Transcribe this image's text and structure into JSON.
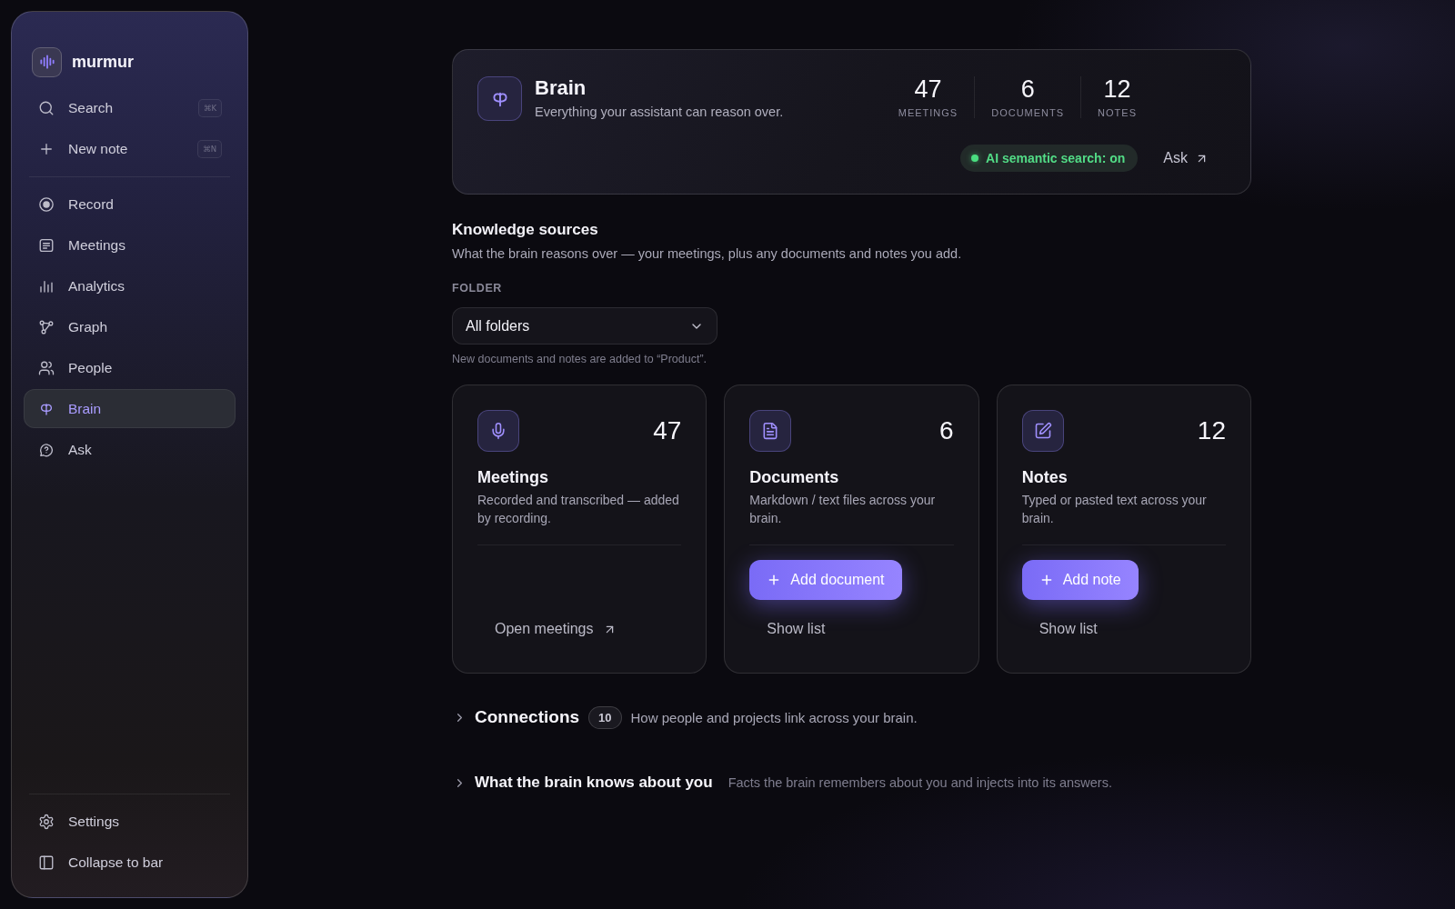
{
  "sidebar": {
    "app_name": "murmur",
    "quick_actions": [
      {
        "kind": "search",
        "label": "Search",
        "shortcut": "⌘K"
      },
      {
        "kind": "new",
        "label": "New note",
        "shortcut": "⌘N"
      }
    ],
    "nav": [
      {
        "kind": "record",
        "label": "Record",
        "selected": false
      },
      {
        "kind": "meetings",
        "label": "Meetings",
        "selected": false
      },
      {
        "kind": "analytics",
        "label": "Analytics",
        "selected": false
      },
      {
        "kind": "graph",
        "label": "Graph",
        "selected": false
      },
      {
        "kind": "people",
        "label": "People",
        "selected": false
      },
      {
        "kind": "brain",
        "label": "Brain",
        "selected": true
      },
      {
        "kind": "ask",
        "label": "Ask",
        "selected": false
      }
    ],
    "footer": [
      {
        "kind": "settings",
        "label": "Settings"
      },
      {
        "kind": "collapse",
        "label": "Collapse to bar"
      }
    ]
  },
  "header": {
    "title": "Brain",
    "subtitle": "Everything your assistant can reason over.",
    "stats": [
      {
        "value": "47",
        "label": "MEETINGS"
      },
      {
        "value": "6",
        "label": "DOCUMENTS"
      },
      {
        "value": "12",
        "label": "NOTES"
      }
    ],
    "semantic_search": {
      "label": "AI semantic search: on",
      "on": true
    },
    "ask_link": "Ask"
  },
  "knowledge_sources": {
    "title": "Knowledge sources",
    "description": "What the brain reasons over — your meetings, plus any documents and notes you add.",
    "folder": {
      "label": "FOLDER",
      "value": "All folders",
      "hint": "New documents and notes are added to “Product”."
    },
    "cards": [
      {
        "kind": "meetings",
        "count": "47",
        "title": "Meetings",
        "description": "Recorded and transcribed — added by recording.",
        "actions": [
          {
            "kind": "link",
            "label": "Open meetings"
          }
        ]
      },
      {
        "kind": "documents",
        "count": "6",
        "title": "Documents",
        "description": "Markdown / text files across your brain.",
        "actions": [
          {
            "kind": "primary",
            "label": "Add document"
          },
          {
            "kind": "ghost",
            "label": "Show list"
          }
        ]
      },
      {
        "kind": "notes",
        "count": "12",
        "title": "Notes",
        "description": "Typed or pasted text across your brain.",
        "actions": [
          {
            "kind": "primary",
            "label": "Add note"
          },
          {
            "kind": "ghost",
            "label": "Show list"
          }
        ]
      }
    ]
  },
  "sections": [
    {
      "kind": "large",
      "title": "Connections",
      "count": "10",
      "description": "How people and projects link across your brain.",
      "expanded": false
    },
    {
      "kind": "small",
      "title": "What the brain knows about you",
      "description": "Facts the brain remembers about you and injects into its answers.",
      "expanded": false
    }
  ]
}
